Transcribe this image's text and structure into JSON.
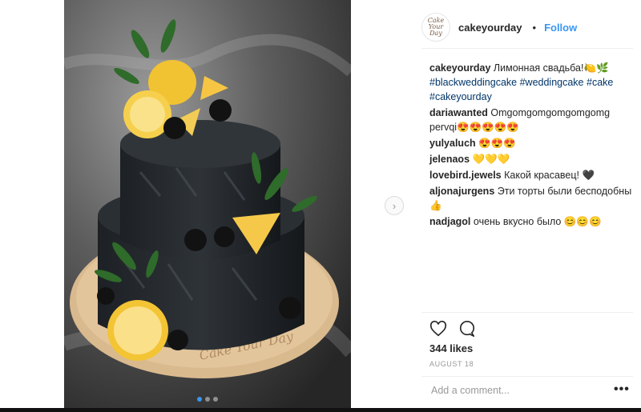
{
  "post": {
    "image_alt": "",
    "carousel_total": 3,
    "carousel_active": 1
  },
  "header": {
    "username": "cakeyourday",
    "separator": "•",
    "follow_label": "Follow",
    "avatar_text": "Cake Your Day"
  },
  "caption": {
    "username": "cakeyourday",
    "text": "Лимонная свадьба!🍋🌿",
    "hashtags": [
      "#blackweddingcake",
      "#weddingcake",
      "#cake",
      "#cakeyourday"
    ]
  },
  "comments": [
    {
      "username": "dariawanted",
      "text": "Omgomgomgomgomgomg pervqi😍😍😍😍😍"
    },
    {
      "username": "yulyaluch",
      "text": "😍😍😍"
    },
    {
      "username": "jelenaos",
      "text": "💛💛💛"
    },
    {
      "username": "lovebird.jewels",
      "text": "Какой красавец! 🖤"
    },
    {
      "username": "aljonajurgens",
      "text": "Эти торты были бесподобны 👍"
    },
    {
      "username": "nadjagol",
      "text": "очень вкусно было 😊😊😊"
    }
  ],
  "actions": {
    "like_icon": "heart-icon",
    "comment_icon": "comment-bubble-icon",
    "likes_text": "344 likes",
    "date_text": "AUGUST 18"
  },
  "composer": {
    "placeholder": "Add a comment...",
    "more_label": "•••"
  },
  "nav": {
    "next_label": "›"
  },
  "colors": {
    "accent": "#3897f0",
    "hashtag": "#003569",
    "muted": "#999999"
  }
}
